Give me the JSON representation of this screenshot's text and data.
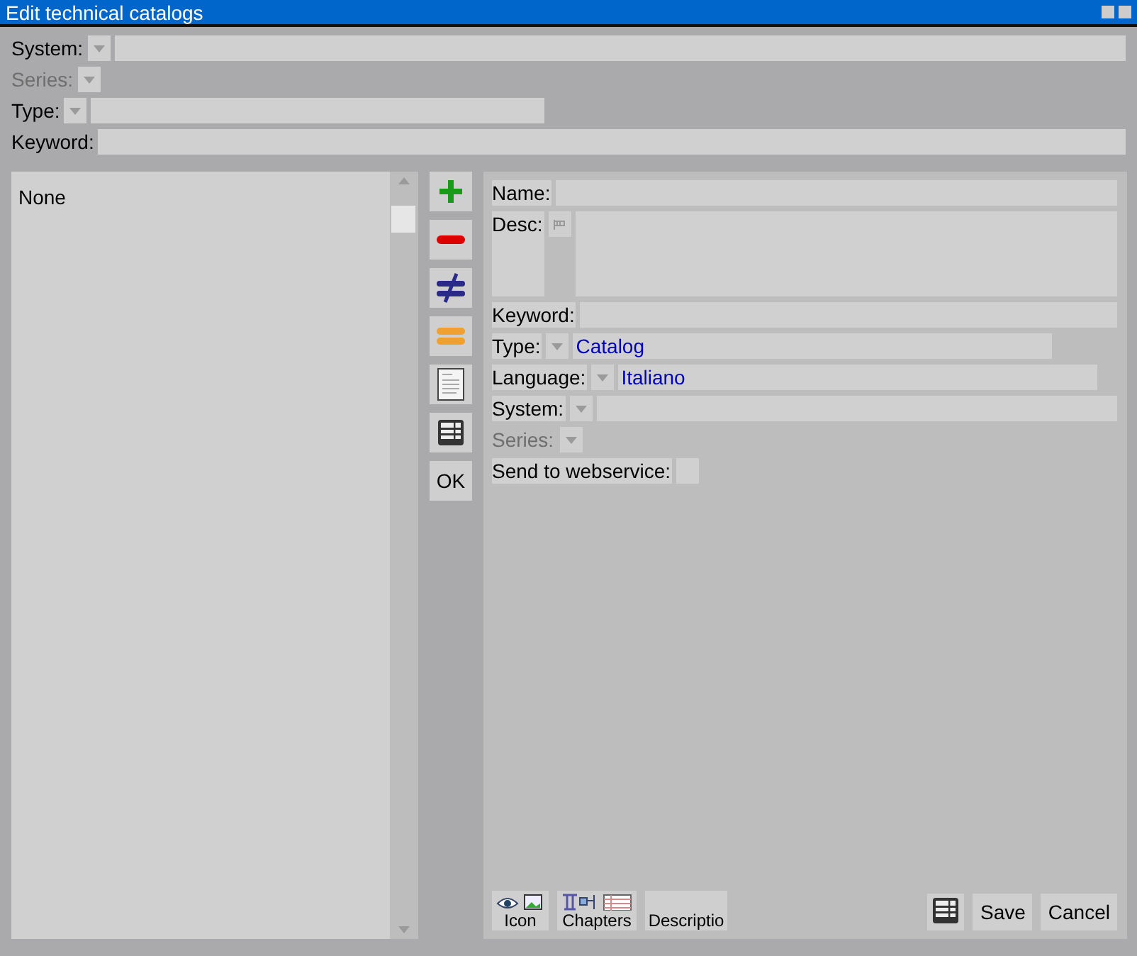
{
  "window": {
    "title": "Edit technical catalogs"
  },
  "filters": [
    {
      "kind": "combo",
      "label": "System:",
      "disabled": false
    },
    {
      "kind": "dropdown",
      "label": "Series:",
      "disabled": true
    },
    {
      "kind": "combo",
      "label": "Type:",
      "disabled": false
    },
    {
      "kind": "text",
      "label": "Keyword:",
      "disabled": false
    }
  ],
  "list": {
    "items": [
      "None"
    ]
  },
  "toolbar": [
    {
      "kind": "add"
    },
    {
      "kind": "remove"
    },
    {
      "kind": "different"
    },
    {
      "kind": "equal"
    },
    {
      "kind": "document"
    },
    {
      "kind": "table"
    },
    {
      "kind": "ok",
      "label": "OK"
    }
  ],
  "form": [
    {
      "kind": "text",
      "label": "Name:"
    },
    {
      "kind": "textarea",
      "label": "Desc:"
    },
    {
      "kind": "text",
      "label": "Keyword:"
    },
    {
      "kind": "combo",
      "label": "Type:",
      "value": "Catalog",
      "disabled": false
    },
    {
      "kind": "combo",
      "label": "Language:",
      "value": "Italiano",
      "disabled": false
    },
    {
      "kind": "combo",
      "label": "System:",
      "disabled": false
    },
    {
      "kind": "dropdown",
      "label": "Series:",
      "disabled": true
    },
    {
      "kind": "checkbox",
      "label": "Send to webservice:",
      "checked": false
    }
  ],
  "bottom_tabs": [
    {
      "kind": "icon",
      "label": "Icon"
    },
    {
      "kind": "chapters",
      "label": "Chapters"
    },
    {
      "kind": "plain",
      "label": "Descriptio"
    }
  ],
  "buttons": [
    "Save",
    "Cancel"
  ]
}
